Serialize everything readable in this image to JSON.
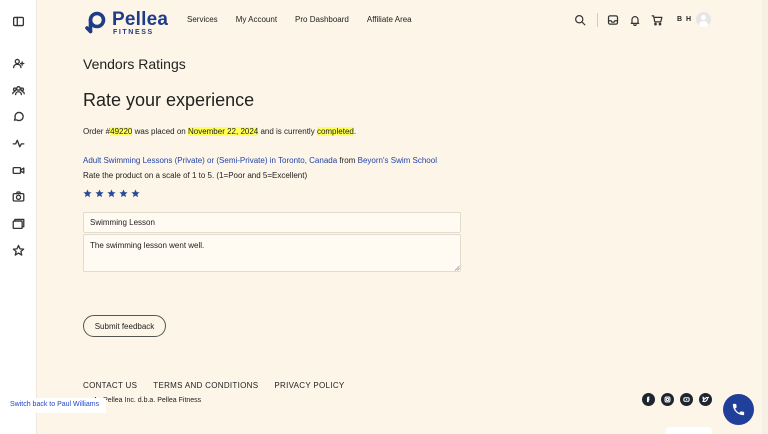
{
  "rail": {
    "icons": [
      "sidebar-toggle-icon",
      "user-add-icon",
      "users-icon",
      "chat-icon",
      "activity-icon",
      "video-icon",
      "camera-icon",
      "folders-icon",
      "star-icon"
    ]
  },
  "header": {
    "brand": "Pellea",
    "brand_sub": "FITNESS",
    "nav": [
      "Services",
      "My Account",
      "Pro Dashboard",
      "Affiliate Area"
    ],
    "initials": "B H",
    "icons": [
      "search-icon",
      "inbox-icon",
      "bell-icon",
      "cart-icon"
    ]
  },
  "main": {
    "section_title": "Vendors Ratings",
    "page_title": "Rate your experience",
    "order": {
      "prefix": "Order #",
      "number": "49220",
      "mid1": " was placed on ",
      "date": "November 22, 2024",
      "mid2": " and is currently ",
      "status": "completed",
      "suffix": "."
    },
    "product": {
      "name": "Adult Swimming Lessons (Private) or (Semi-Private) in Toronto, Canada",
      "from": " from ",
      "vendor": "Beyorn's Swim School"
    },
    "scale_text": "Rate the product on a scale of 1 to 5. (1=Poor and 5=Excellent)",
    "rating": 5,
    "review_title_value": "Swimming Lesson",
    "review_text_value": "The swimming lesson went well.",
    "submit_label": "Submit feedback"
  },
  "footer": {
    "links": [
      "CONTACT US",
      "TERMS AND CONDITIONS",
      "PRIVACY POLICY"
    ],
    "copyright": "4 - Pellea Inc. d.b.a. Pellea Fitness",
    "switch_back": "Switch back to Paul Williams",
    "socials": [
      "facebook-icon",
      "instagram-icon",
      "youtube-icon",
      "twitter-icon"
    ]
  },
  "colors": {
    "background": "#fdf5e8",
    "brand": "#1f3c88",
    "highlight": "#ffff55",
    "link": "#2244aa"
  }
}
